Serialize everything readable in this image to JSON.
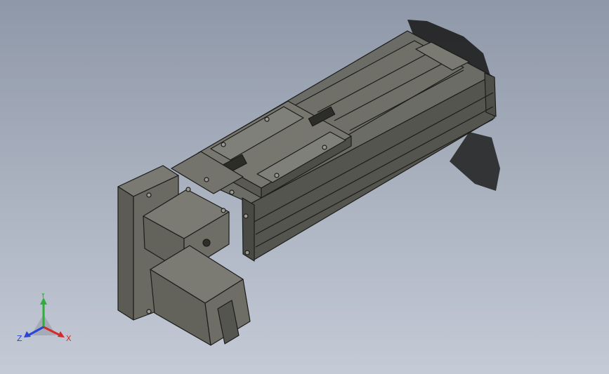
{
  "viewport": {
    "background_top": "#8f98a8",
    "background_bottom": "#c4cad6"
  },
  "model": {
    "body_color": "#60605a",
    "edge_color": "#1c1c1a",
    "shadow_color": "#1e1e1e"
  },
  "triad": {
    "x_label": "X",
    "y_label": "Y",
    "z_label": "Z",
    "x_color": "#d42a2a",
    "y_color": "#2fae3a",
    "z_color": "#2a44d4"
  }
}
